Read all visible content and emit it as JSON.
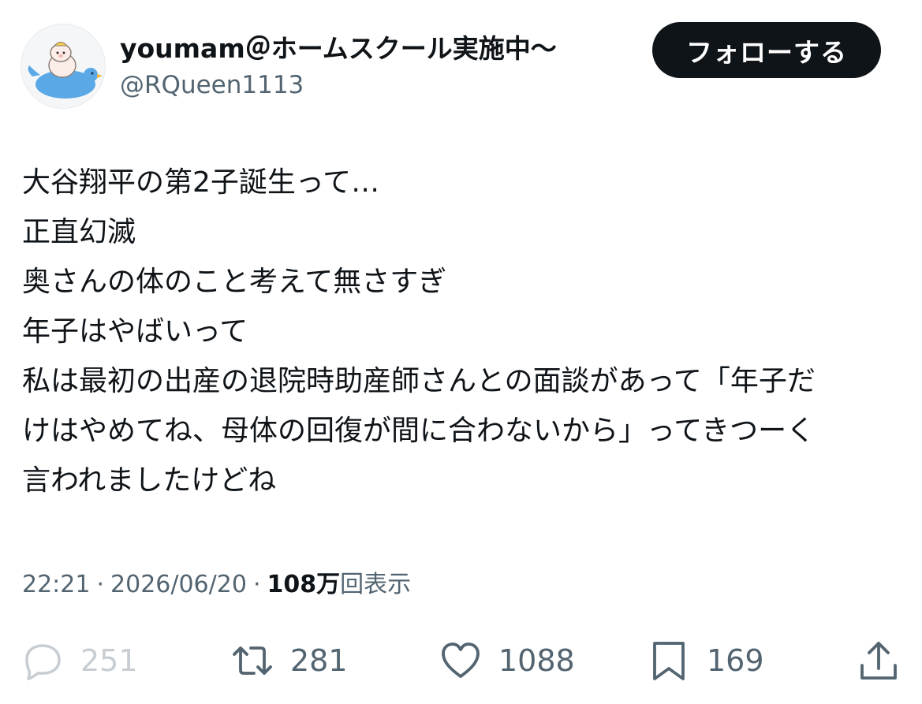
{
  "user": {
    "display_name": "youmam＠ホームスクール実施中〜",
    "handle": "@RQueen1113",
    "avatar_icon": "bird-avatar-icon"
  },
  "follow_button": {
    "label": "フォローする"
  },
  "tweet": {
    "lines": [
      "大谷翔平の第2子誕生って…",
      "正直幻滅",
      "奥さんの体のこと考えて無さすぎ",
      "年子はやばいって",
      "私は最初の出産の退院時助産師さんとの面談があって「年子だ",
      "けはやめてね、母体の回復が間に合わないから」ってきつーく",
      "言われましたけどね"
    ]
  },
  "meta": {
    "time": "22:21",
    "separator": "·",
    "date": "2026/06/20",
    "views_count": "108万",
    "views_label": "回表示"
  },
  "actions": {
    "reply": {
      "icon": "reply-icon",
      "count": "251"
    },
    "retweet": {
      "icon": "retweet-icon",
      "count": "281"
    },
    "like": {
      "icon": "heart-icon",
      "count": "1088"
    },
    "bookmark": {
      "icon": "bookmark-icon",
      "count": "169"
    },
    "share": {
      "icon": "share-icon"
    }
  },
  "colors": {
    "text_primary": "#0f1419",
    "text_secondary": "#536471",
    "button_bg": "#0f1419",
    "avatar_bird": "#5aa9e6"
  }
}
